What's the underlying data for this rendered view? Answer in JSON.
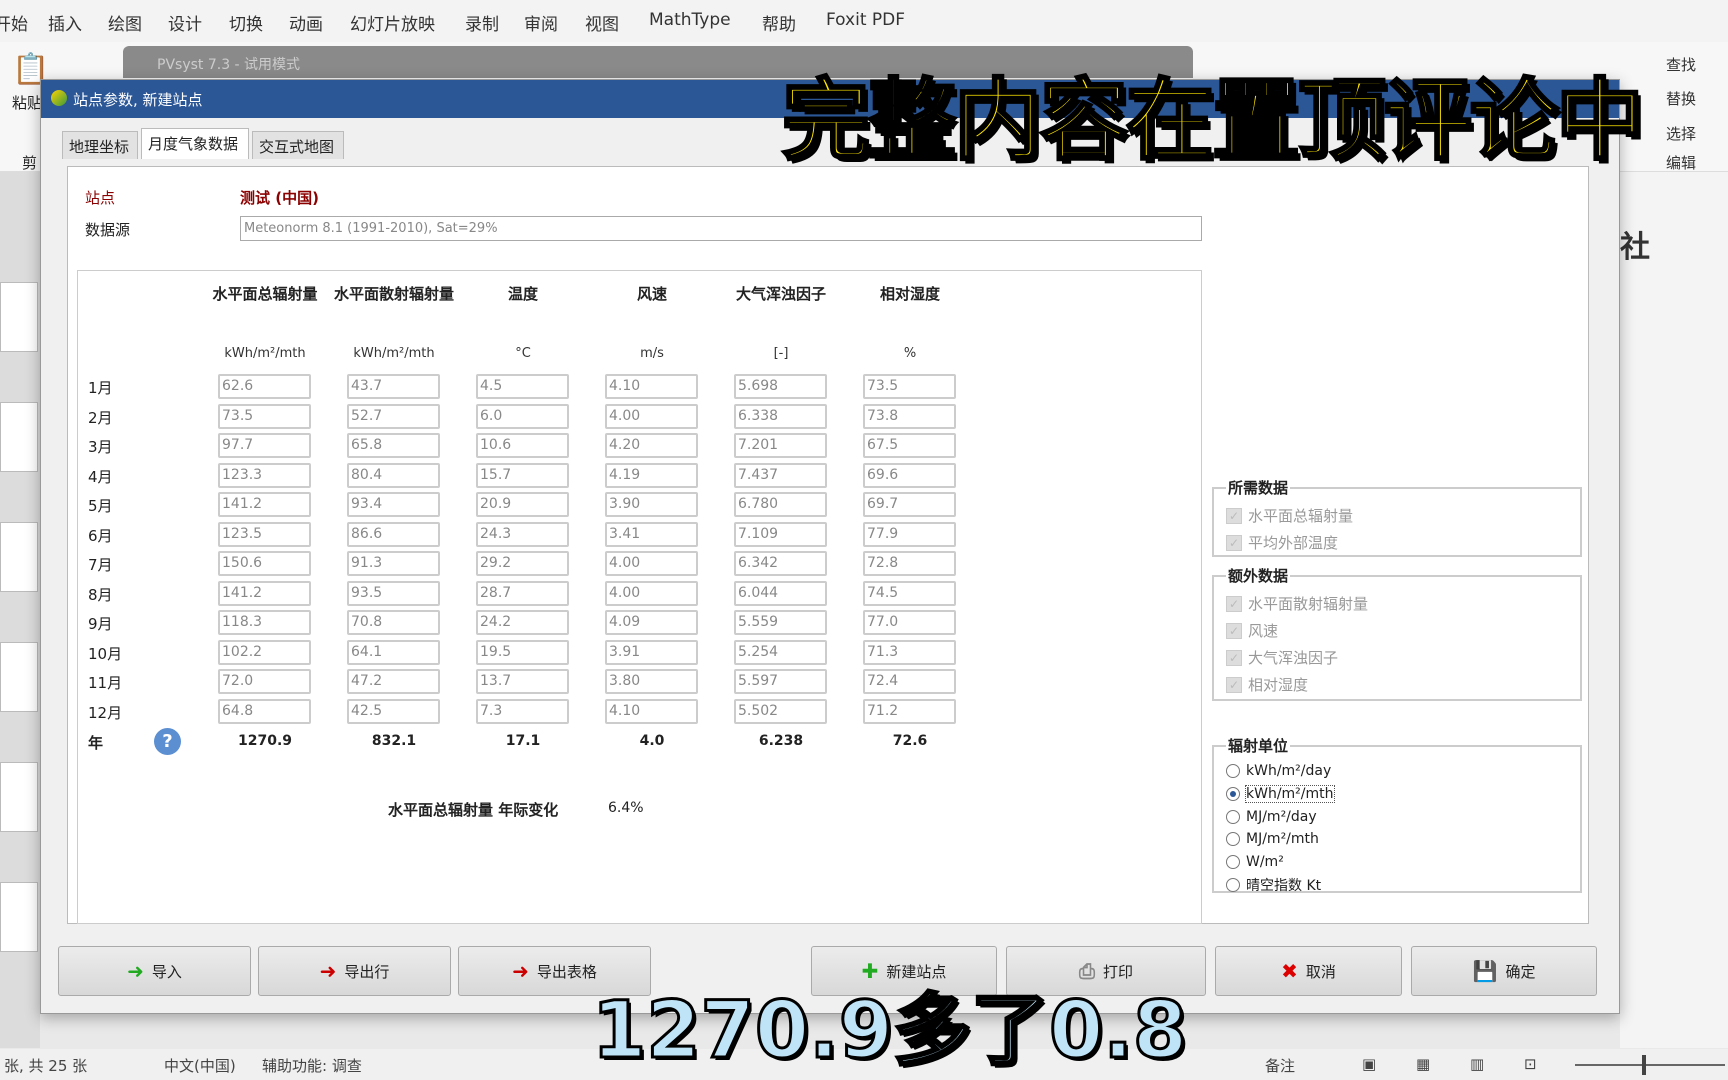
{
  "menubar": {
    "items": [
      "开始",
      "插入",
      "绘图",
      "设计",
      "切换",
      "动画",
      "幻灯片放映",
      "录制",
      "审阅",
      "视图",
      "MathType",
      "帮助",
      "Foxit PDF"
    ]
  },
  "ribbon": {
    "paste": "粘贴",
    "clipboard": "剪",
    "find": "查找",
    "replace": "替换",
    "select": "选择",
    "edit": "编辑",
    "partial_right": "社"
  },
  "background_window": {
    "title": "PVsyst 7.3 - 试用模式"
  },
  "dialog": {
    "title": "站点参数, 新建站点",
    "tabs": [
      {
        "label": "地理坐标"
      },
      {
        "label": "月度气象数据",
        "active": true
      },
      {
        "label": "交互式地图"
      }
    ],
    "site_label": "站点",
    "site_value": "测试 (中国)",
    "site_color": "#8b0000",
    "source_label": "数据源",
    "source_value": "Meteonorm 8.1 (1991-2010), Sat=29%",
    "table": {
      "headers": [
        "水平面总辐射量",
        "水平面散射辐射量",
        "温度",
        "风速",
        "大气浑浊因子",
        "相对湿度"
      ],
      "units": [
        "kWh/m²/mth",
        "kWh/m²/mth",
        "°C",
        "m/s",
        "[-]",
        "%"
      ],
      "months": [
        "1月",
        "2月",
        "3月",
        "4月",
        "5月",
        "6月",
        "7月",
        "8月",
        "9月",
        "10月",
        "11月",
        "12月"
      ],
      "rows": [
        [
          "62.6",
          "43.7",
          "4.5",
          "4.10",
          "5.698",
          "73.5"
        ],
        [
          "73.5",
          "52.7",
          "6.0",
          "4.00",
          "6.338",
          "73.8"
        ],
        [
          "97.7",
          "65.8",
          "10.6",
          "4.20",
          "7.201",
          "67.5"
        ],
        [
          "123.3",
          "80.4",
          "15.7",
          "4.19",
          "7.437",
          "69.6"
        ],
        [
          "141.2",
          "93.4",
          "20.9",
          "3.90",
          "6.780",
          "69.7"
        ],
        [
          "123.5",
          "86.6",
          "24.3",
          "3.41",
          "7.109",
          "77.9"
        ],
        [
          "150.6",
          "91.3",
          "29.2",
          "4.00",
          "6.342",
          "72.8"
        ],
        [
          "141.2",
          "93.5",
          "28.7",
          "4.00",
          "6.044",
          "74.5"
        ],
        [
          "118.3",
          "70.8",
          "24.2",
          "4.09",
          "5.559",
          "77.0"
        ],
        [
          "102.2",
          "64.1",
          "19.5",
          "3.91",
          "5.254",
          "71.3"
        ],
        [
          "72.0",
          "47.2",
          "13.7",
          "3.80",
          "5.597",
          "72.4"
        ],
        [
          "64.8",
          "42.5",
          "7.3",
          "4.10",
          "5.502",
          "71.2"
        ]
      ],
      "year_label": "年",
      "help_icon": "?",
      "totals": [
        "1270.9",
        "832.1",
        "17.1",
        "4.0",
        "6.238",
        "72.6"
      ]
    },
    "variability_label": "水平面总辐射量 年际变化",
    "variability_value": "6.4%",
    "required": {
      "legend": "所需数据",
      "items": [
        "水平面总辐射量",
        "平均外部温度"
      ]
    },
    "extra": {
      "legend": "额外数据",
      "items": [
        "水平面散射辐射量",
        "风速",
        "大气浑浊因子",
        "相对湿度"
      ]
    },
    "units_group": {
      "legend": "辐射单位",
      "options": [
        "kWh/m²/day",
        "kWh/m²/mth",
        "MJ/m²/day",
        "MJ/m²/mth",
        "W/m²",
        "晴空指数 Kt"
      ],
      "selected": "kWh/m²/mth"
    },
    "buttons": {
      "import": "导入",
      "export_row": "导出行",
      "export_table": "导出表格",
      "new_site": "新建站点",
      "print": "打印",
      "cancel": "取消",
      "ok": "确定"
    }
  },
  "statusbar": {
    "slides": "张, 共 25 张",
    "language": "中文(中国)",
    "accessibility": "辅助功能: 调查",
    "notes": "备注"
  },
  "overlay": {
    "top_text": "完整内容在置顶评论中",
    "caption": "1270.9多了0.8"
  },
  "colors": {
    "title_bar": "#2b5797",
    "overlay_top": "#ffe600",
    "caption": "#bfe4f7"
  }
}
